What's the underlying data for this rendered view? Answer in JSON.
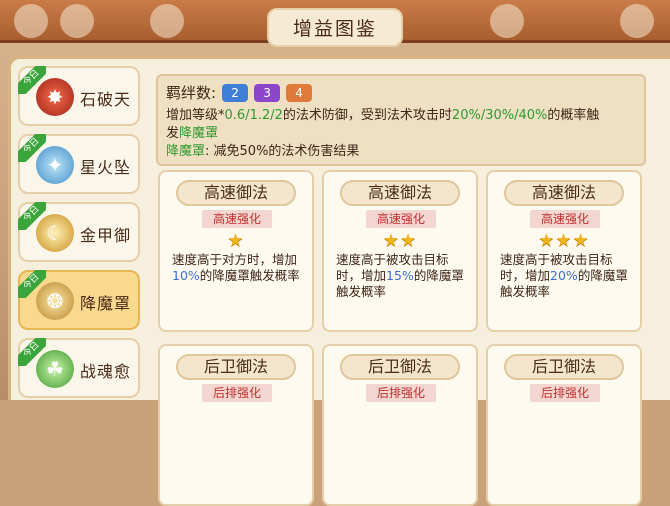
{
  "title": "增益图鉴",
  "sidebar": {
    "today_label": "今日",
    "items": [
      {
        "label": "石破天",
        "icon": "stone-burst-icon",
        "today": true,
        "active": false,
        "color": "#c83a2a"
      },
      {
        "label": "星火坠",
        "icon": "star-fire-icon",
        "today": true,
        "active": false,
        "color": "#5aa9d8"
      },
      {
        "label": "金甲御",
        "icon": "gold-armor-icon",
        "today": true,
        "active": false,
        "color": "#d6a232"
      },
      {
        "label": "降魔罩",
        "icon": "demon-shield-icon",
        "today": true,
        "active": true,
        "color": "#c79a3a"
      },
      {
        "label": "战魂愈",
        "icon": "battle-soul-icon",
        "today": true,
        "active": false,
        "color": "#4ab04a"
      }
    ]
  },
  "bond": {
    "label": "羁绊数:",
    "levels": [
      {
        "value": "2",
        "color": "#3f7fd6"
      },
      {
        "value": "3",
        "color": "#8b46c9"
      },
      {
        "value": "4",
        "color": "#e07a3a"
      }
    ],
    "line1_prefix": "增加等级*",
    "line1_vals": "0.6/1.2/2",
    "line1_mid": "的法术防御，受到法术攻击时",
    "line1_pct": "20%/30%/40%",
    "line1_suffix": "的概率触",
    "line2_prefix": "发",
    "line2_link": "降魔罩",
    "line3_name": "降魔罩",
    "line3_text": ": 减免50%的法术伤害结果"
  },
  "cards": [
    {
      "title": "高速御法",
      "sub": "高速强化",
      "stars": "★",
      "text_pre": "速度高于对方时，增加",
      "text_hl": "10%",
      "text_post": "的降魔罩触发概率"
    },
    {
      "title": "高速御法",
      "sub": "高速强化",
      "stars": "★★",
      "text_pre": "速度高于被攻击目标时，增加",
      "text_hl": "15%",
      "text_post": "的降魔罩触发概率"
    },
    {
      "title": "高速御法",
      "sub": "高速强化",
      "stars": "★★★",
      "text_pre": "速度高于被攻击目标时，增加",
      "text_hl": "20%",
      "text_post": "的降魔罩触发概率"
    },
    {
      "title": "后卫御法",
      "sub": "后排强化",
      "stars": "",
      "text_pre": "",
      "text_hl": "",
      "text_post": ""
    },
    {
      "title": "后卫御法",
      "sub": "后排强化",
      "stars": "",
      "text_pre": "",
      "text_hl": "",
      "text_post": ""
    },
    {
      "title": "后卫御法",
      "sub": "后排强化",
      "stars": "",
      "text_pre": "",
      "text_hl": "",
      "text_post": ""
    }
  ]
}
